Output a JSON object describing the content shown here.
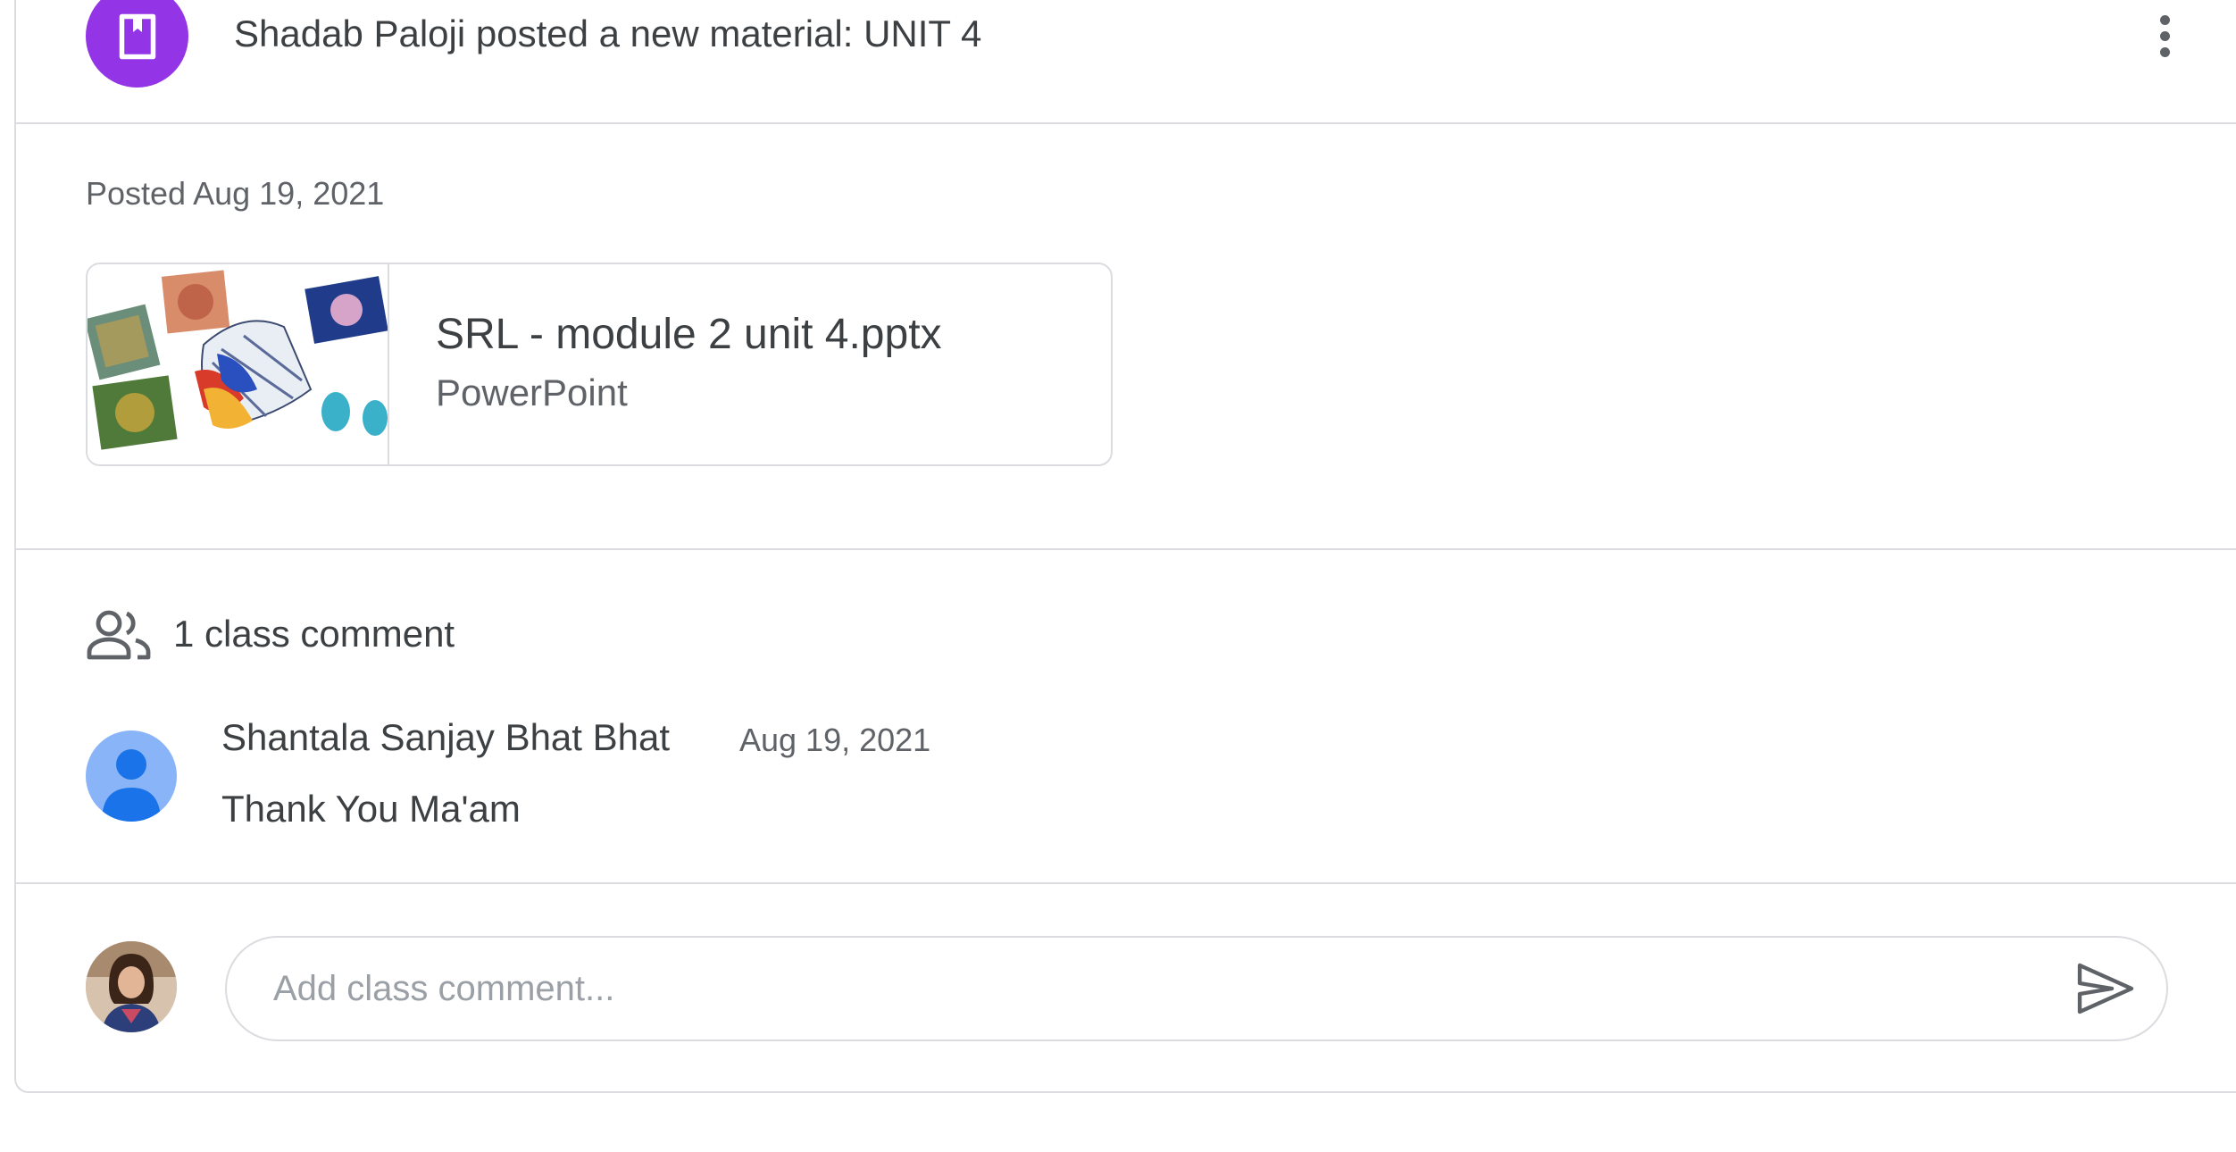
{
  "post": {
    "title": "Shadab Paloji posted a new material: UNIT 4",
    "icon": "classwork-material-icon",
    "accent_color": "#9334e6",
    "posted_label": "Posted Aug 19, 2021"
  },
  "attachment": {
    "title": "SRL - module 2 unit 4.pptx",
    "type": "PowerPoint"
  },
  "comments": {
    "count_label": "1 class comment",
    "items": [
      {
        "author": "Shantala Sanjay Bhat Bhat",
        "date": "Aug 19, 2021",
        "text": "Thank You Ma'am"
      }
    ]
  },
  "add_comment": {
    "placeholder": "Add class comment..."
  }
}
